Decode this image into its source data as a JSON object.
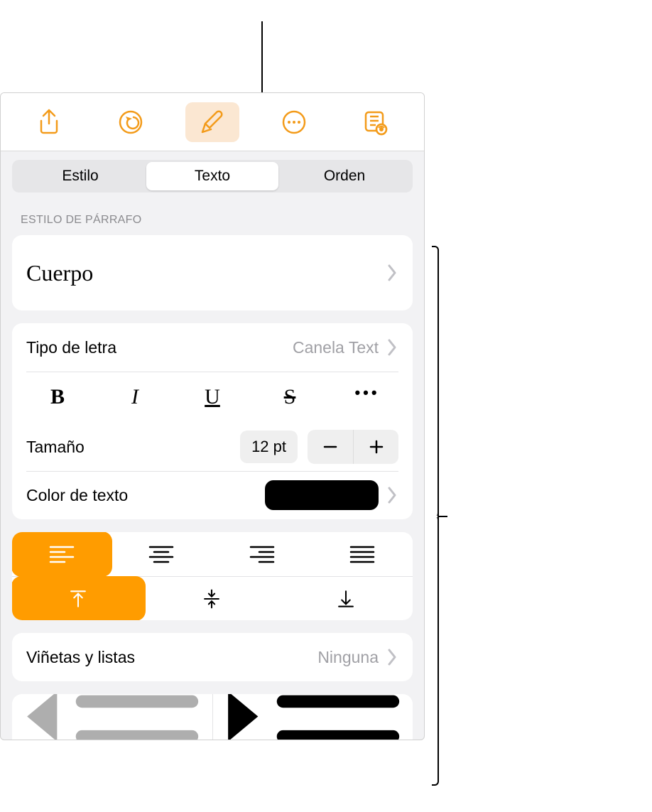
{
  "toolbar": {
    "share_icon": "share-icon",
    "undo_icon": "undo-icon",
    "brush_icon": "format-brush-icon",
    "more_icon": "more-circle-icon",
    "reader_icon": "reader-icon"
  },
  "tabs": {
    "style": "Estilo",
    "text": "Texto",
    "order": "Orden"
  },
  "section_paragraph_style": "ESTILO DE PÁRRAFO",
  "paragraph_style_value": "Cuerpo",
  "font": {
    "label": "Tipo de letra",
    "value": "Canela Text",
    "bold": "B",
    "italic": "I",
    "underline": "U",
    "strike": "S",
    "more": "•••"
  },
  "size": {
    "label": "Tamaño",
    "value": "12 pt"
  },
  "text_color": {
    "label": "Color de texto",
    "value_hex": "#000000"
  },
  "bullets": {
    "label": "Viñetas y listas",
    "value": "Ninguna"
  }
}
